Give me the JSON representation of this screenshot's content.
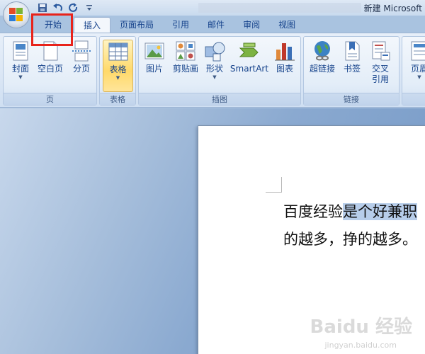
{
  "window": {
    "title": "新建 Microsoft"
  },
  "quick_access": [
    {
      "name": "save-icon"
    },
    {
      "name": "undo-icon"
    },
    {
      "name": "redo-icon"
    },
    {
      "name": "customize-icon"
    }
  ],
  "tabs": [
    "开始",
    "插入",
    "页面布局",
    "引用",
    "邮件",
    "审阅",
    "视图"
  ],
  "ribbon": {
    "groups": [
      {
        "label": "页",
        "buttons": [
          {
            "label": "封面",
            "dropdown": true,
            "icon": "cover-page-icon"
          },
          {
            "label": "空白页",
            "dropdown": false,
            "icon": "blank-page-icon"
          },
          {
            "label": "分页",
            "dropdown": false,
            "icon": "page-break-icon"
          }
        ]
      },
      {
        "label": "表格",
        "buttons": [
          {
            "label": "表格",
            "dropdown": true,
            "icon": "table-icon",
            "highlighted": true
          }
        ]
      },
      {
        "label": "插图",
        "buttons": [
          {
            "label": "图片",
            "dropdown": false,
            "icon": "picture-icon"
          },
          {
            "label": "剪贴画",
            "dropdown": false,
            "icon": "clip-art-icon"
          },
          {
            "label": "形状",
            "dropdown": true,
            "icon": "shapes-icon"
          },
          {
            "label": "SmartArt",
            "dropdown": false,
            "icon": "smartart-icon"
          },
          {
            "label": "图表",
            "dropdown": false,
            "icon": "chart-icon"
          }
        ]
      },
      {
        "label": "链接",
        "buttons": [
          {
            "label": "超链接",
            "dropdown": false,
            "icon": "hyperlink-icon"
          },
          {
            "label": "书签",
            "dropdown": false,
            "icon": "bookmark-icon"
          },
          {
            "label": "交叉\n引用",
            "dropdown": false,
            "icon": "cross-reference-icon"
          }
        ]
      },
      {
        "label": "",
        "buttons": [
          {
            "label": "页眉",
            "dropdown": true,
            "icon": "header-icon"
          }
        ]
      }
    ]
  },
  "document": {
    "line1_plain": "百度经验",
    "line1_selected": "是个好兼职",
    "line2": "的越多，挣的越多。"
  },
  "colors": {
    "highlight_box": "#e8231b",
    "selection": "#b7cdea",
    "ribbon_text": "#15428b"
  }
}
